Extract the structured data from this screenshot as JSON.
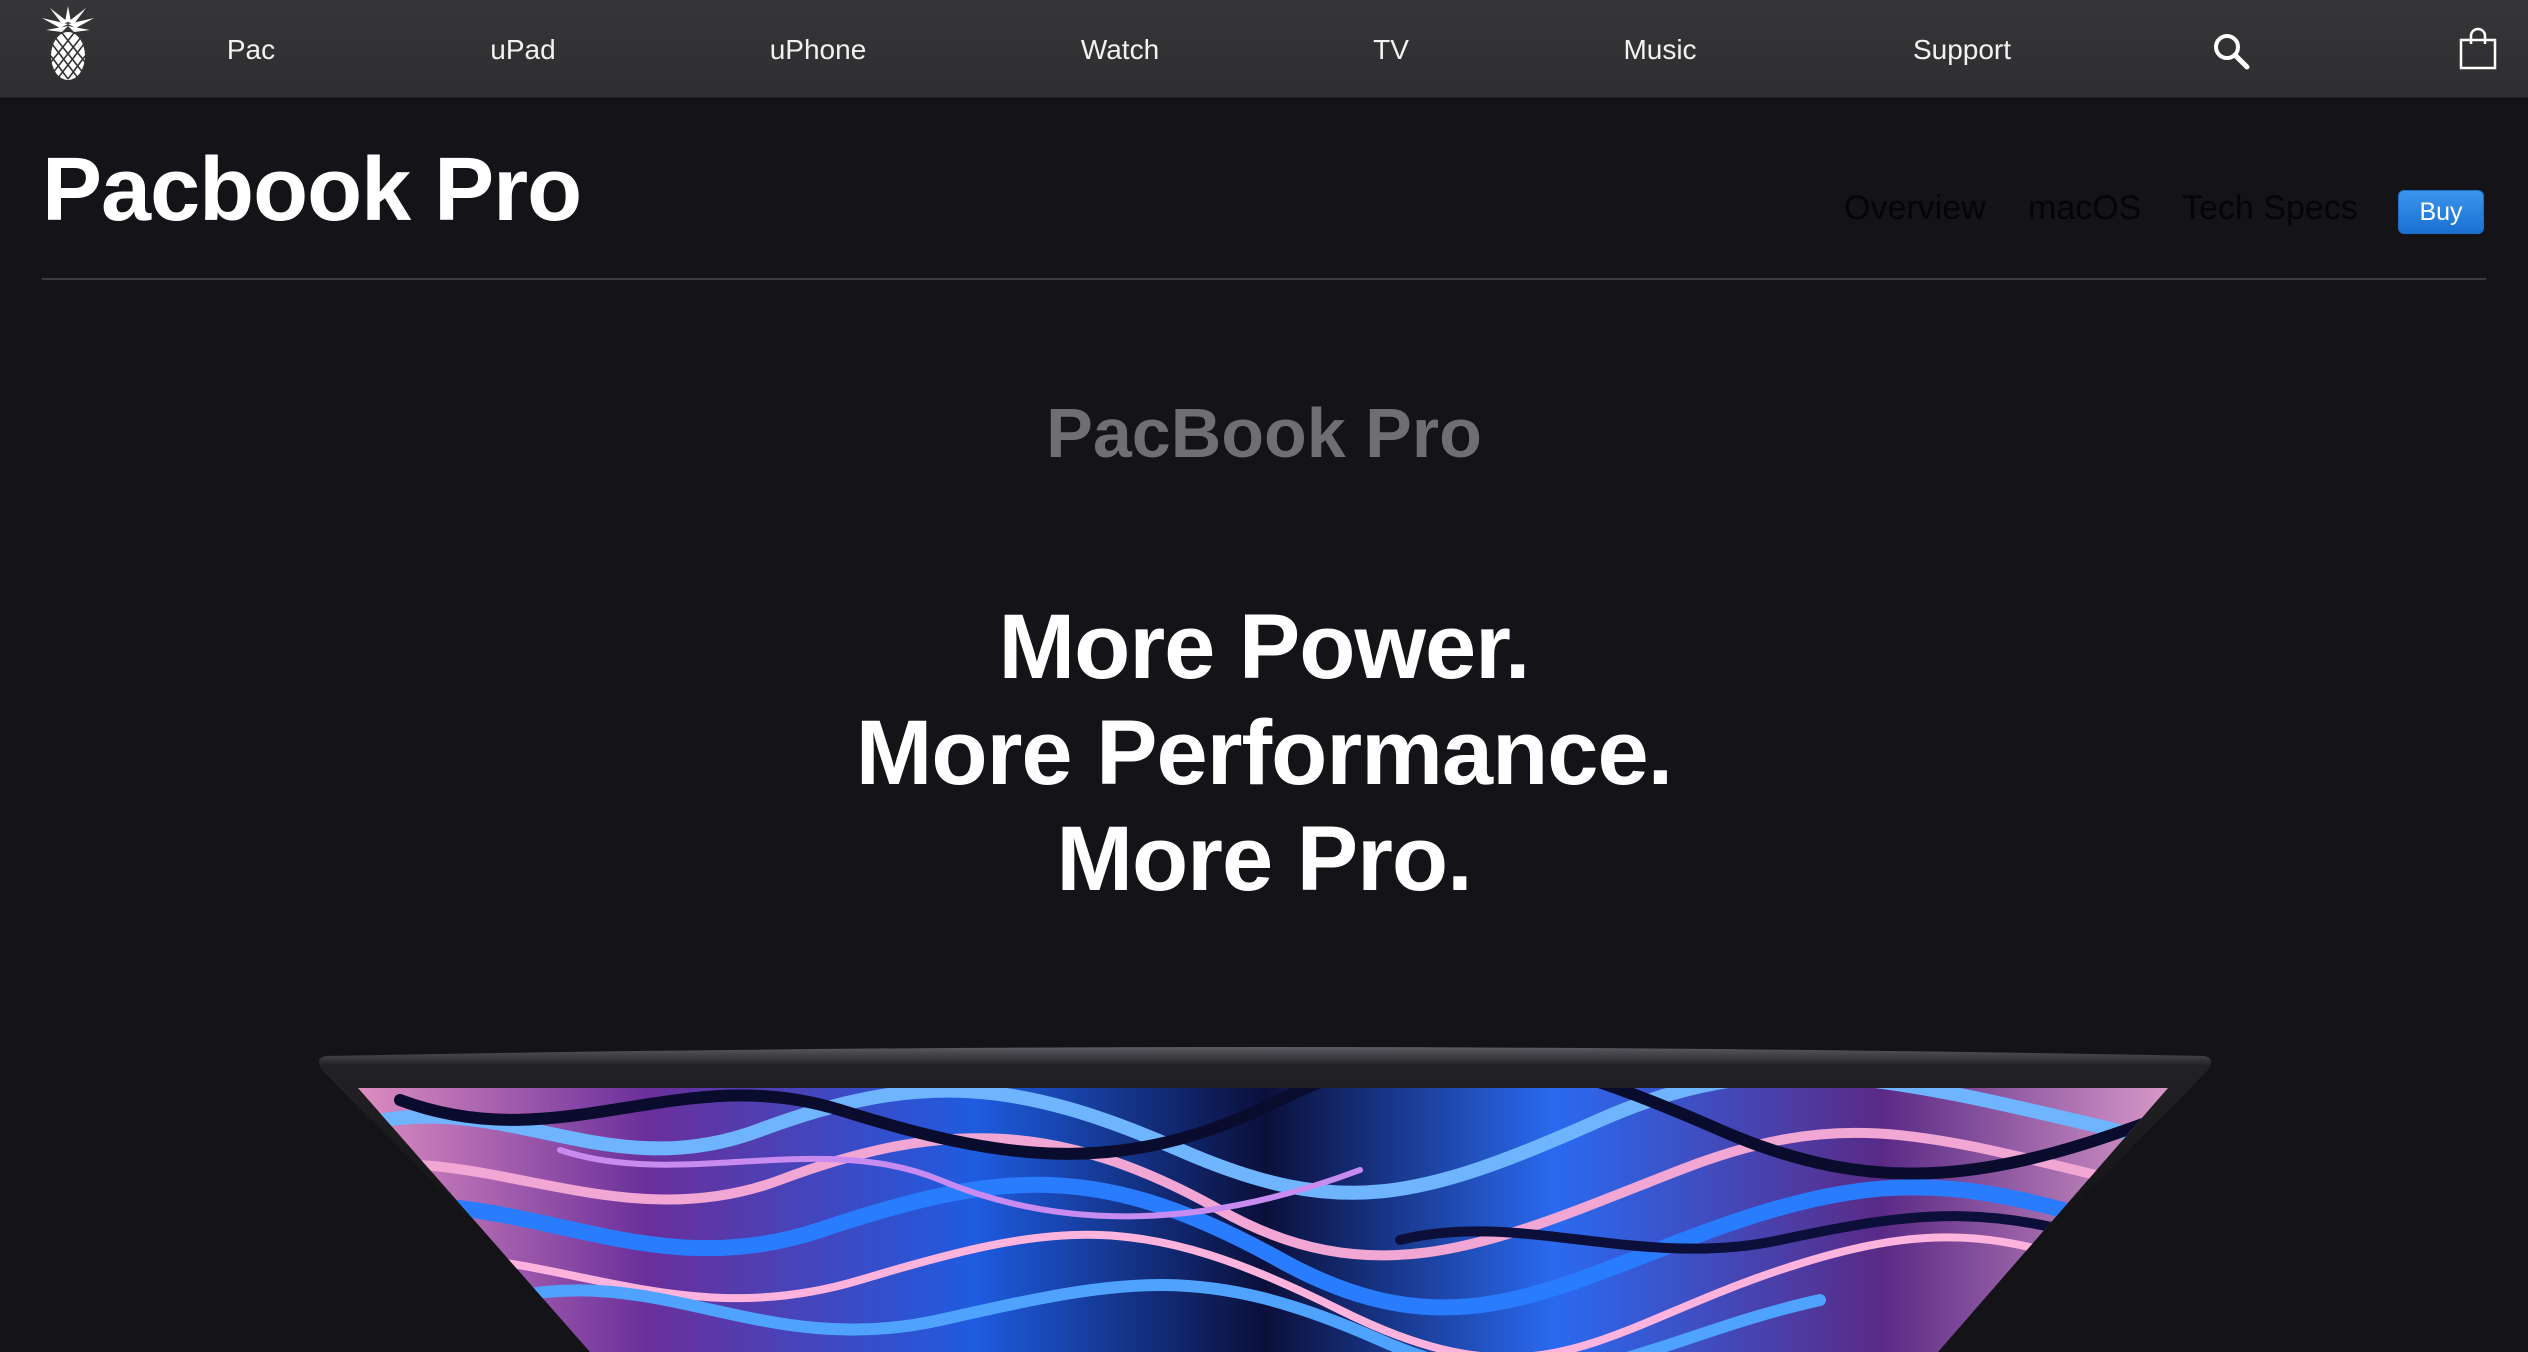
{
  "global_nav": {
    "logo_icon": "pineapple-logo-icon",
    "items": [
      {
        "label": "Pac"
      },
      {
        "label": "uPad"
      },
      {
        "label": "uPhone"
      },
      {
        "label": "Watch"
      },
      {
        "label": "TV"
      },
      {
        "label": "Music"
      },
      {
        "label": "Support"
      }
    ],
    "search_icon": "search-icon",
    "bag_icon": "shopping-bag-icon"
  },
  "local_nav": {
    "title": "Pacbook Pro",
    "links": [
      {
        "label": "Overview"
      },
      {
        "label": "macOS"
      },
      {
        "label": "Tech Specs"
      }
    ],
    "buy_label": "Buy"
  },
  "hero": {
    "eyebrow": "PacBook Pro",
    "headline_lines": [
      "More Power.",
      "More Performance.",
      "More Pro."
    ],
    "image": "laptop-screen-image"
  },
  "colors": {
    "page_background": "#141418",
    "nav_background": "#333335",
    "buy_button": "#1a70d2",
    "eyebrow_text": "#6e6e73"
  }
}
